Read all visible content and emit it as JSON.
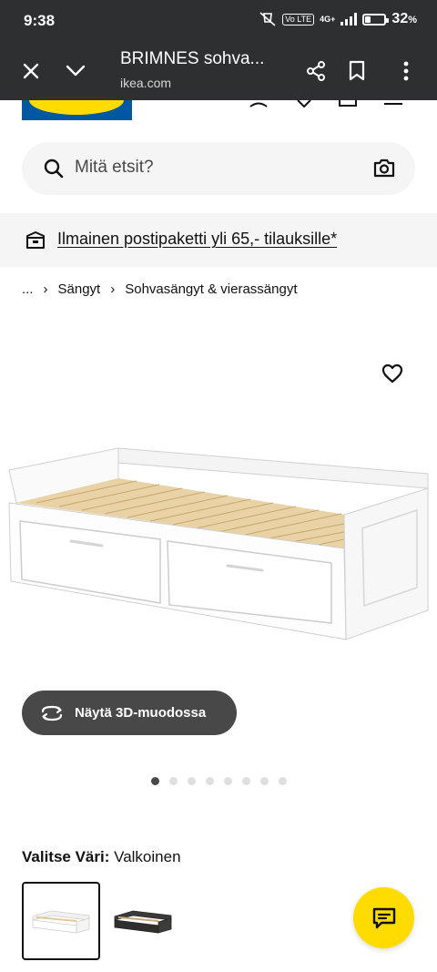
{
  "status_bar": {
    "time": "9:38",
    "network": "4G+",
    "volte_label": "Vo LTE",
    "battery_percent": 32,
    "battery_label": "32",
    "battery_unit": "%"
  },
  "tab_bar": {
    "title": "BRIMNES sohva...",
    "url": "ikea.com",
    "icons": [
      "close-icon",
      "chevron-down-icon",
      "share-icon",
      "bookmark-icon",
      "more-vertical-icon"
    ]
  },
  "search": {
    "placeholder": "Mitä etsit?",
    "icons": [
      "search-icon",
      "camera-icon"
    ]
  },
  "promo": {
    "text": "Ilmainen postipaketti yli 65,- tilauksille*",
    "icon": "package-icon"
  },
  "breadcrumb": {
    "items": [
      "...",
      "Sängyt",
      "Sohvasängyt & vierassängyt"
    ],
    "separator": "›"
  },
  "gallery": {
    "button_3d": "Näytä 3D-muodossa",
    "image_count": 8,
    "active_index": 0
  },
  "color": {
    "label": "Valitse Väri:",
    "selected": "Valkoinen",
    "swatches": [
      "white",
      "black"
    ]
  },
  "colors": {
    "chrome_bg": "#2e2f31",
    "ikea_blue": "#0058a3",
    "ikea_yellow": "#ffdb00",
    "pill_bg": "#f5f5f5",
    "button_dark": "#484848"
  }
}
